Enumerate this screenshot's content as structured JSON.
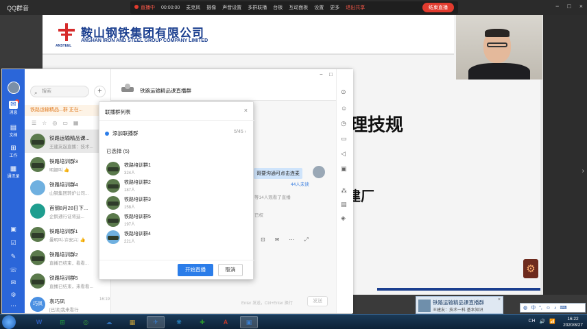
{
  "top_bar": {
    "app_title": "QQ群音",
    "live_status": "直播中",
    "live_timer": "00:00:00",
    "tools": [
      "麦克风",
      "摄像",
      "声音设置",
      "多群联播",
      "台板",
      "互动面板",
      "设置",
      "更多"
    ],
    "exit_share": "退出共享",
    "end_live": "结束直播",
    "window_controls": [
      "−",
      "□",
      "×"
    ]
  },
  "slide": {
    "company_cn": "鞍山钢铁集团有限公司",
    "company_en": "ANSHAN IRON AND STEEL GROUP COMPANY LIMITED",
    "logo_text": "ANSTEEL",
    "big_text": "理技规",
    "mid_text": "建厂",
    "colors": {
      "brand": "#1b3f8f"
    }
  },
  "messenger": {
    "rail": {
      "items": [
        {
          "icon": "chat-icon",
          "label": "消息"
        },
        {
          "icon": "doc-icon",
          "label": "文档"
        },
        {
          "icon": "apps-icon",
          "label": "工作"
        },
        {
          "icon": "contacts-icon",
          "label": "通讯录"
        }
      ]
    },
    "search_placeholder": "搜索",
    "live_banner": "铁路运输精品...群 正在...",
    "conversations": [
      {
        "name": "铁路运输精品课...",
        "preview": "王建友起直播：技术...",
        "time": "16:",
        "avatar": "train",
        "selected": true
      },
      {
        "name": "铁路培训群3",
        "preview": "明娜叫 👍",
        "time": "16:",
        "avatar": "train"
      },
      {
        "name": "铁路培训群4",
        "preview": "山钢集团转炉公司...",
        "time": "16:",
        "avatar": "sky"
      },
      {
        "name": "首钢8月28日下...",
        "preview": "企鹅通行证将延...",
        "time": "16:",
        "avatar": "teal"
      },
      {
        "name": "铁路培训群1",
        "preview": "曼明叫-许安兴: 👍",
        "time": "16:",
        "avatar": "train"
      },
      {
        "name": "铁路培训群2",
        "preview": "直播已结束，看看...",
        "time": "16:",
        "avatar": "train"
      },
      {
        "name": "铁路培训群5",
        "preview": "直播已结束，来看看...",
        "time": "16:",
        "avatar": "train"
      },
      {
        "name": "袁巧凤",
        "preview": "[已读]我来看行",
        "time": "16:19",
        "avatar": "blue",
        "avatar_text": "巧凤"
      }
    ],
    "chat": {
      "title": "铁路运输精品课直播群",
      "bubble": "哥要沟通可点击连麦",
      "unread": "44人未读",
      "sys1": "等14人观看了直播",
      "sys2": "已权",
      "input_hint": "Enter 发送，Ctrl+Enter 换行",
      "send": "发送"
    }
  },
  "modal": {
    "title": "联播群列表",
    "add_label": "添加联播群",
    "add_count": "5/45",
    "selected_label": "已选择 (5)",
    "groups": [
      {
        "name": "铁路培训群1",
        "count": "324人"
      },
      {
        "name": "铁路培训群2",
        "count": "187人"
      },
      {
        "name": "铁路培训群3",
        "count": "158人"
      },
      {
        "name": "铁路培训群5",
        "count": "197人"
      },
      {
        "name": "铁路培训群4",
        "count": "221人"
      }
    ],
    "start_button": "开始直播",
    "cancel_button": "取消"
  },
  "notification": {
    "title": "铁路运输精品课直播群",
    "text": "王建友：技术一科 基本知识"
  },
  "ime": {
    "label": "中"
  },
  "taskbar": {
    "apps": [
      "W",
      "⊞",
      "◎",
      "☁",
      "▦",
      "✈",
      "❋",
      "✚",
      "A",
      "▣"
    ],
    "tray": [
      "CH",
      "🔊",
      "📶"
    ],
    "time": "16:22",
    "date": "2020/8/27"
  }
}
